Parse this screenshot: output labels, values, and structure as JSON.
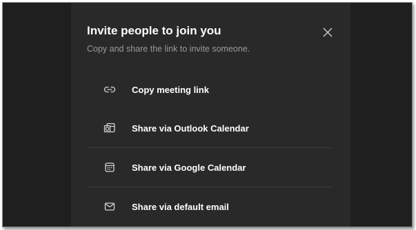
{
  "dialog": {
    "title": "Invite people to join you",
    "subtitle": "Copy and share the link to invite someone.",
    "close_icon": "close-icon"
  },
  "options": [
    {
      "label": "Copy meeting link",
      "icon": "link-icon"
    },
    {
      "label": "Share via Outlook Calendar",
      "icon": "outlook-calendar-icon"
    },
    {
      "label": "Share via Google Calendar",
      "icon": "calendar-icon"
    },
    {
      "label": "Share via default email",
      "icon": "mail-icon"
    }
  ],
  "colors": {
    "background": "#1f1f1f",
    "dialog": "#292929",
    "text": "#ffffff",
    "muted_text": "#9a9a9a",
    "divider": "#3b3b3b"
  }
}
